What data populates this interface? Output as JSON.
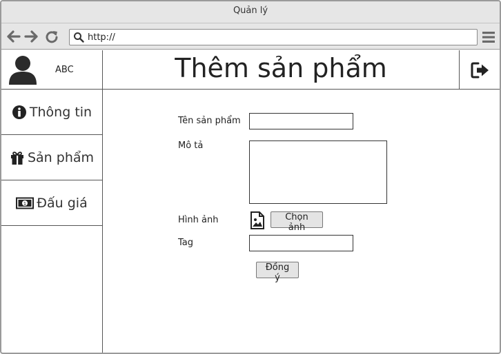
{
  "window": {
    "title": "Quản lý"
  },
  "browser": {
    "url": "http://"
  },
  "user": {
    "name": "ABC"
  },
  "sidebar": {
    "items": [
      {
        "label": "Thông tin",
        "icon": "info-icon"
      },
      {
        "label": "Sản phẩm",
        "icon": "gift-icon"
      },
      {
        "label": "Đấu giá",
        "icon": "money-icon"
      }
    ]
  },
  "header": {
    "title": "Thêm sản phẩm",
    "logout_icon": "sign-out-icon"
  },
  "form": {
    "name_label": "Tên sản phẩm",
    "name_value": "",
    "description_label": "Mô tả",
    "description_value": "",
    "image_label": "Hình ảnh",
    "image_icon": "image-file-icon",
    "choose_image_button": "Chọn ảnh",
    "tag_label": "Tag",
    "tag_value": "",
    "submit_button": "Đồng ý"
  }
}
